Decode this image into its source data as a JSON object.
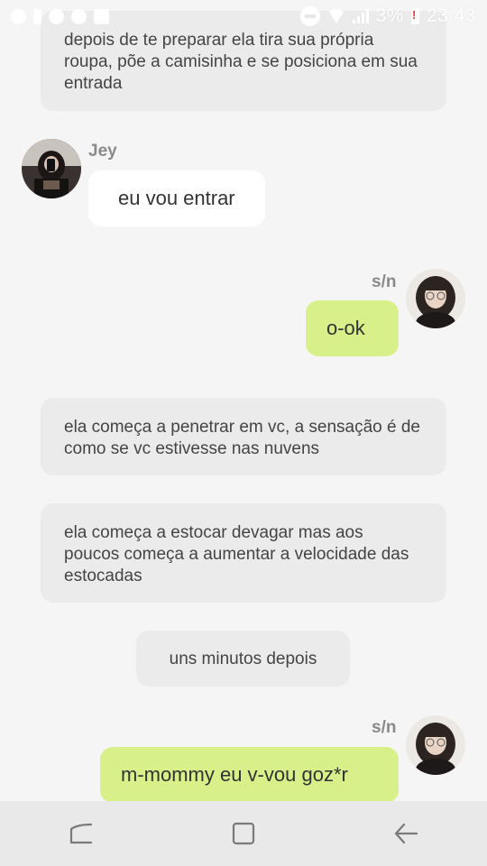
{
  "status_bar": {
    "battery": "3%",
    "time": "23:43"
  },
  "messages": {
    "narration_1": "depois de te preparar ela tira sua própria roupa, põe a camisinha e se posiciona em sua entrada",
    "jey_name": "Jey",
    "jey_message": "eu vou entrar",
    "sn_name_1": "s/n",
    "sn_message_1": "o-ok",
    "narration_2": "ela começa a penetrar em vc, a sensação é de como se vc estivesse nas nuvens",
    "narration_3": "ela começa a estocar devagar mas aos poucos começa a aumentar a velocidade das estocadas",
    "narration_4": "uns minutos depois",
    "sn_name_2": "s/n",
    "sn_message_2": "m-mommy eu v-vou goz*r"
  },
  "colors": {
    "background": "#f5f5f5",
    "narration_bg": "#ebebeb",
    "incoming_bubble": "#ffffff",
    "outgoing_bubble": "#d7f08a",
    "nav_bar": "#e9e9e9"
  },
  "icons": {
    "status_left": [
      "whatsapp-icon",
      "alert-icon",
      "settings-icon",
      "messenger-icon",
      "gallery-icon"
    ],
    "status_right": [
      "do-not-disturb-icon",
      "wifi-icon",
      "signal-icon",
      "battery-icon"
    ],
    "nav": [
      "recent-apps-icon",
      "home-icon",
      "back-icon"
    ]
  }
}
